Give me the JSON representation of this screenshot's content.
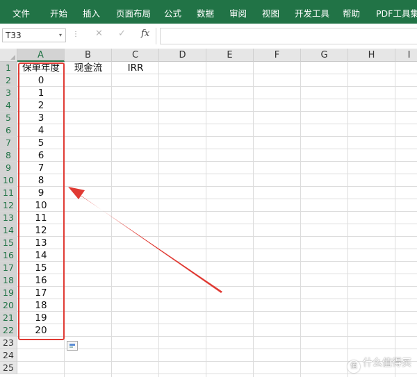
{
  "ribbon": {
    "tabs": [
      "文件",
      "开始",
      "插入",
      "页面布局",
      "公式",
      "数据",
      "审阅",
      "视图",
      "开发工具",
      "帮助",
      "PDF工具集"
    ]
  },
  "formula_bar": {
    "name_box": "T33",
    "formula": ""
  },
  "sheet": {
    "columns": [
      "A",
      "B",
      "C",
      "D",
      "E",
      "F",
      "G",
      "H",
      "I"
    ],
    "rows": [
      "1",
      "2",
      "3",
      "4",
      "5",
      "6",
      "7",
      "8",
      "9",
      "10",
      "11",
      "12",
      "13",
      "14",
      "15",
      "16",
      "17",
      "18",
      "19",
      "20",
      "21",
      "22",
      "23",
      "24",
      "25"
    ],
    "headers": {
      "A1": "保单年度",
      "B1": "现金流",
      "C1": "IRR"
    },
    "col_a_values": [
      "0",
      "1",
      "2",
      "3",
      "4",
      "5",
      "6",
      "7",
      "8",
      "9",
      "10",
      "11",
      "12",
      "13",
      "14",
      "15",
      "16",
      "17",
      "18",
      "19",
      "20"
    ]
  },
  "colors": {
    "ribbon": "#217346",
    "highlight": "#e03a33",
    "arrow": "#e03a33"
  },
  "watermark": "什么值得买"
}
